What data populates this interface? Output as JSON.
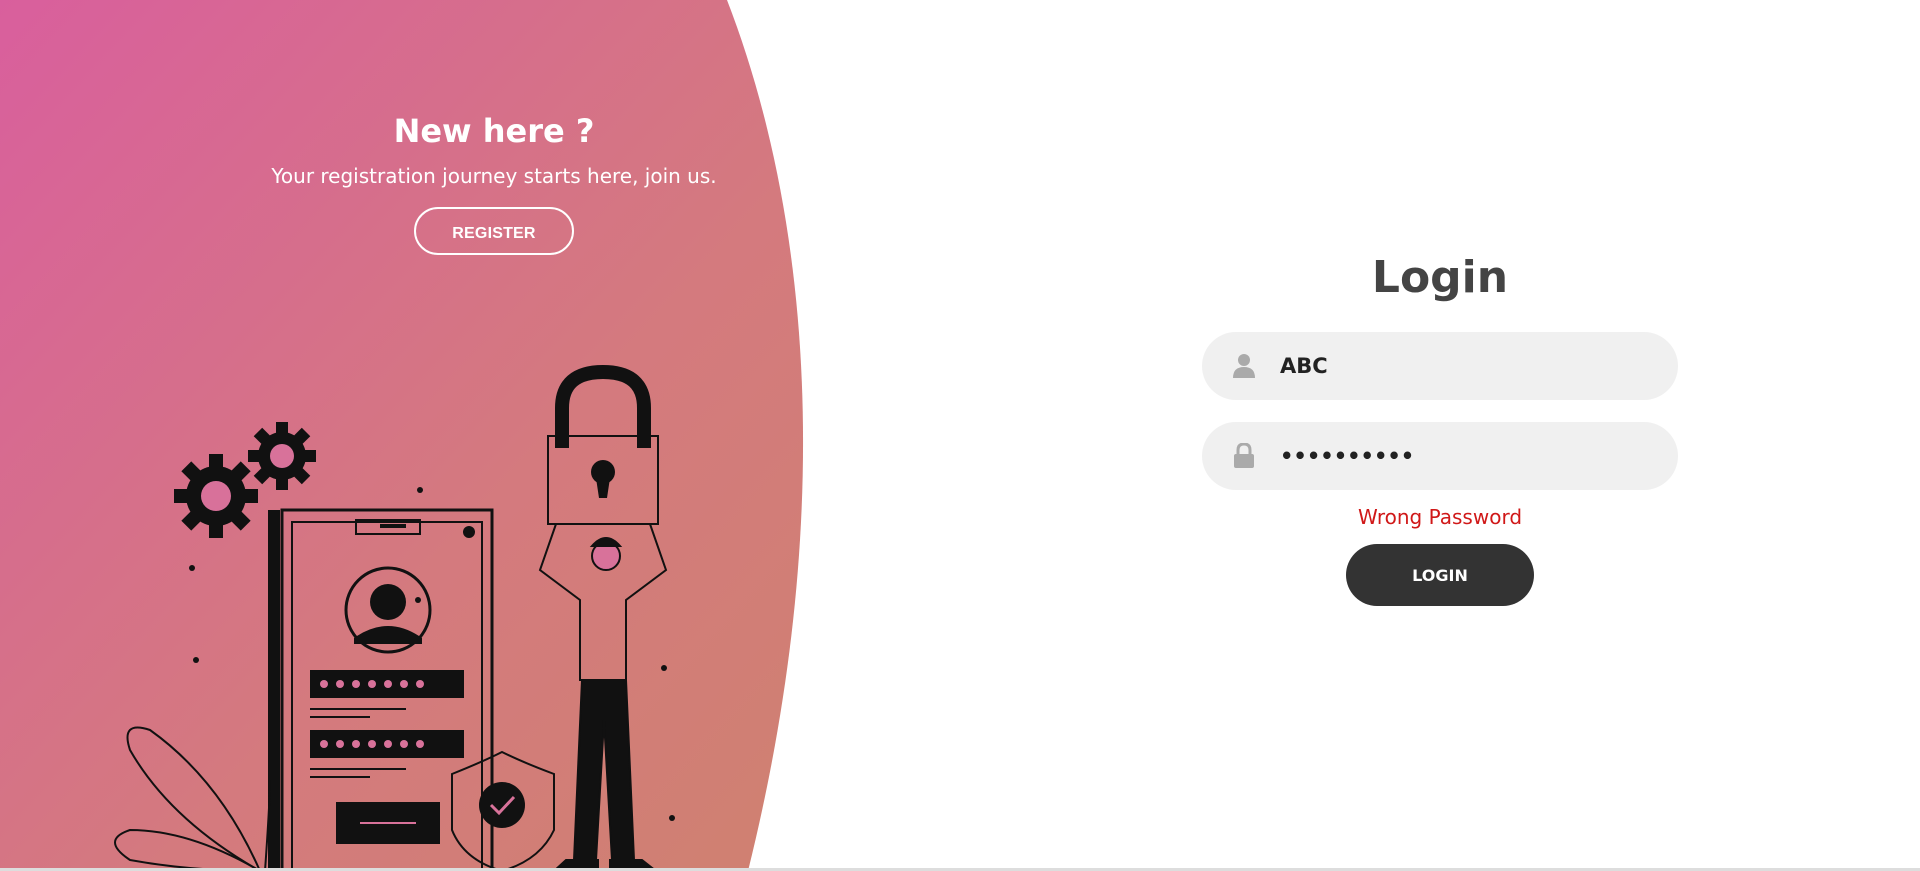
{
  "register": {
    "title": "New here ?",
    "subtitle": "Your registration journey starts here, join us.",
    "button_label": "REGISTER"
  },
  "login": {
    "title": "Login",
    "username": {
      "icon": "user-icon",
      "value": "ABC"
    },
    "password": {
      "icon": "lock-icon",
      "value": "••••••••••"
    },
    "error": "Wrong Password",
    "button_label": "LOGIN"
  },
  "colors": {
    "panel_gradient_start": "#d8609c",
    "panel_gradient_end": "#d37f72",
    "error": "#d01818",
    "login_button": "#333333",
    "field_bg": "#f0f0f0"
  },
  "illustration": {
    "icon": "security-login-illustration"
  }
}
